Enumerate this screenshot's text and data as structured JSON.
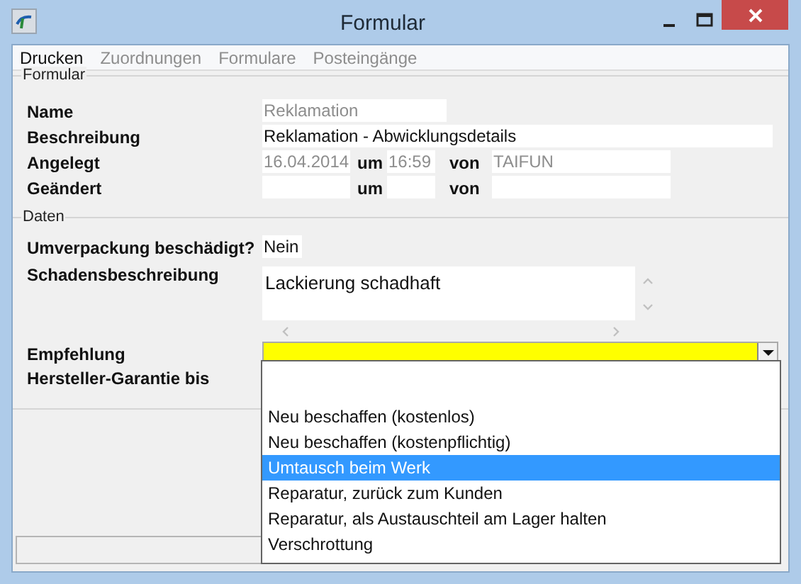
{
  "window": {
    "title": "Formular"
  },
  "menu": [
    {
      "label": "Drucken",
      "disabled": false
    },
    {
      "label": "Zuordnungen",
      "disabled": true
    },
    {
      "label": "Formulare",
      "disabled": true
    },
    {
      "label": "Posteingänge",
      "disabled": true
    }
  ],
  "formular": {
    "legend": "Formular",
    "name": {
      "label": "Name",
      "value": "Reklamation",
      "disabled": true
    },
    "beschreibung": {
      "label": "Beschreibung",
      "value": "Reklamation - Abwicklungsdetails",
      "disabled": false
    },
    "rows": [
      {
        "label": "Angelegt",
        "date": "16.04.2014",
        "um": "um",
        "time": "16:59",
        "von": "von",
        "user": "TAIFUN"
      },
      {
        "label": "Geändert",
        "um": "um",
        "von": "von"
      }
    ]
  },
  "daten": {
    "legend": "Daten",
    "umverpackung": {
      "label": "Umverpackung beschädigt?",
      "value": "Nein"
    },
    "schaden": {
      "label": "Schadensbeschreibung",
      "value": "Lackierung schadhaft"
    },
    "empfehlung": {
      "label": "Empfehlung",
      "expanded": true,
      "options": [
        {
          "label": "Neu beschaffen (kostenlos)",
          "selected": false
        },
        {
          "label": "Neu beschaffen (kostenpflichtig)",
          "selected": false
        },
        {
          "label": "Umtausch beim Werk",
          "selected": true
        },
        {
          "label": "Reparatur, zurück zum Kunden",
          "selected": false
        },
        {
          "label": "Reparatur, als Austauschteil am Lager halten",
          "selected": false
        },
        {
          "label": "Verschrottung",
          "selected": false
        }
      ]
    },
    "garantie": {
      "label": "Hersteller-Garantie bis"
    }
  }
}
